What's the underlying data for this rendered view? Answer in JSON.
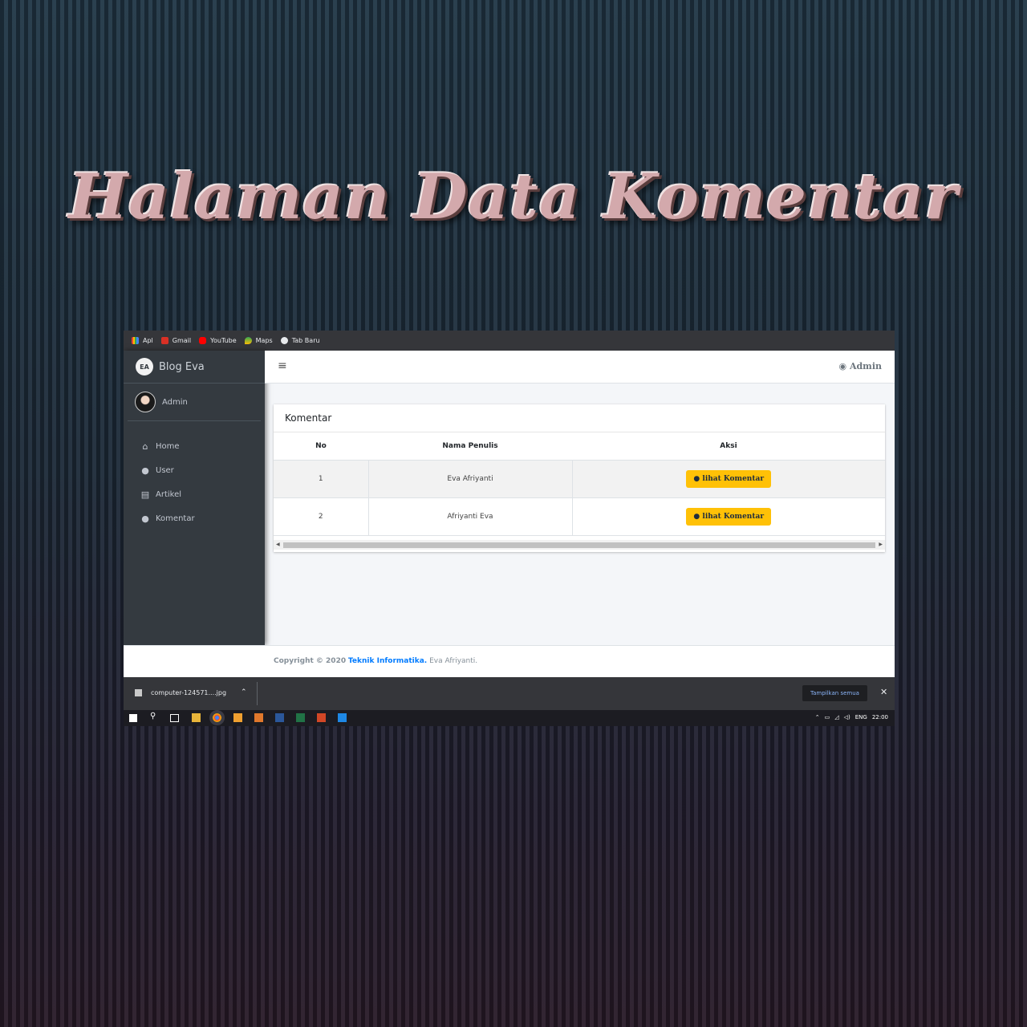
{
  "banner": {
    "title": "Halaman Data Komentar"
  },
  "bookmarks": [
    {
      "label": "Apl",
      "icon": "apps-grid-icon"
    },
    {
      "label": "Gmail",
      "icon": "gmail-icon"
    },
    {
      "label": "YouTube",
      "icon": "youtube-icon"
    },
    {
      "label": "Maps",
      "icon": "maps-pin-icon"
    },
    {
      "label": "Tab Baru",
      "icon": "globe-icon"
    }
  ],
  "sidebar": {
    "brand": "Blog Eva",
    "brand_logo": "EA",
    "user": "Admin",
    "items": [
      {
        "label": "Home",
        "icon": "home-icon"
      },
      {
        "label": "User",
        "icon": "user-icon"
      },
      {
        "label": "Artikel",
        "icon": "book-icon"
      },
      {
        "label": "Komentar",
        "icon": "comment-icon"
      }
    ]
  },
  "header": {
    "menu_icon": "hamburger-icon",
    "user_label": "Admin"
  },
  "card": {
    "title": "Komentar",
    "columns": [
      "No",
      "Nama Penulis",
      "Aksi"
    ],
    "rows": [
      {
        "no": "1",
        "nama": "Eva Afriyanti",
        "aksi": "lihat Komentar"
      },
      {
        "no": "2",
        "nama": "Afriyanti Eva",
        "aksi": "lihat Komentar"
      }
    ]
  },
  "footer": {
    "prefix": "Copyright © 2020",
    "link": "Teknik Informatika.",
    "suffix": "Eva Afriyanti."
  },
  "download_bar": {
    "file": "computer-124571....jpg",
    "show_all": "Tampilkan semua",
    "close": "✕"
  },
  "taskbar": {
    "lang": "ENG",
    "time": "22:00"
  },
  "colors": {
    "accent_button": "#ffc107",
    "sidebar": "#343a40",
    "link": "#007bff"
  }
}
